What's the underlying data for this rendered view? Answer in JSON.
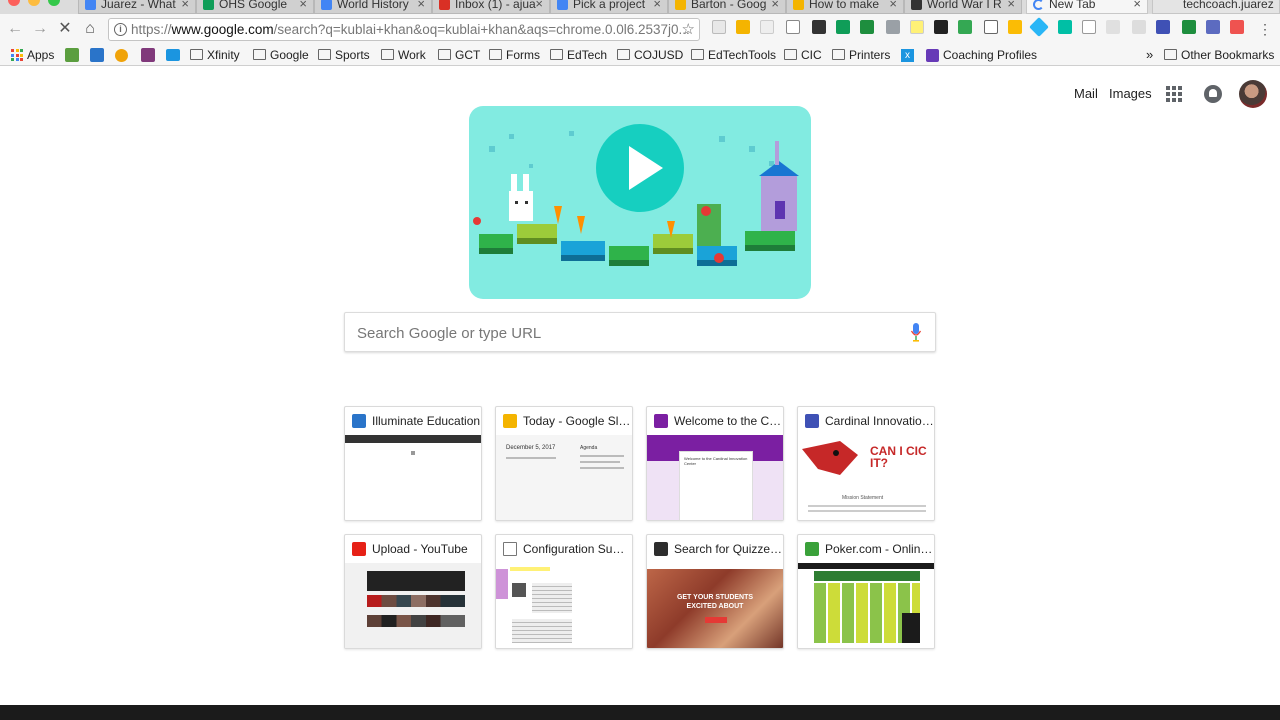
{
  "tabs": [
    {
      "title": "Juarez - What",
      "icon_color": "#4285f4"
    },
    {
      "title": "OHS Google",
      "icon_color": "#0f9d58"
    },
    {
      "title": "World History",
      "icon_color": "#4285f4"
    },
    {
      "title": "Inbox (1) - ajua",
      "icon_color": "#d93025"
    },
    {
      "title": "Pick a project",
      "icon_color": "#4285f4"
    },
    {
      "title": "Barton - Goog",
      "icon_color": "#f4b400"
    },
    {
      "title": "How to make",
      "icon_color": "#f4b400"
    },
    {
      "title": "World War I R",
      "icon_color": "#333333"
    },
    {
      "title": "New Tab",
      "icon_color": "#4285f4"
    }
  ],
  "profile_name": "techcoach.juarez",
  "omnibox": {
    "url_prefix": "https://",
    "url_domain": "www.google.com",
    "url_rest": "/search?q=kublai+khan&oq=kublai+khan&aqs=chrome.0.0l6.2537j0..."
  },
  "bookmarks": [
    {
      "label": "Apps",
      "kind": "apps"
    },
    {
      "label": "",
      "kind": "green"
    },
    {
      "label": "",
      "kind": "blue"
    },
    {
      "label": "",
      "kind": "orange-dot"
    },
    {
      "label": "",
      "kind": "onenote"
    },
    {
      "label": "",
      "kind": "twitter"
    },
    {
      "label": "Xfinity",
      "kind": "folder"
    },
    {
      "label": "Google",
      "kind": "folder"
    },
    {
      "label": "Sports",
      "kind": "folder"
    },
    {
      "label": "Work",
      "kind": "folder"
    },
    {
      "label": "GCT",
      "kind": "folder"
    },
    {
      "label": "Forms",
      "kind": "folder"
    },
    {
      "label": "EdTech",
      "kind": "folder"
    },
    {
      "label": "COJUSD",
      "kind": "folder"
    },
    {
      "label": "EdTechTools",
      "kind": "folder"
    },
    {
      "label": "CIC",
      "kind": "folder"
    },
    {
      "label": "Printers",
      "kind": "folder"
    },
    {
      "label": "",
      "kind": "x-blue"
    },
    {
      "label": "Coaching Profiles",
      "kind": "forms"
    }
  ],
  "overflow_chevron": "»",
  "other_bookmarks": "Other Bookmarks",
  "header": {
    "mail": "Mail",
    "images": "Images"
  },
  "search": {
    "placeholder": "Search Google or type URL"
  },
  "tiles": [
    {
      "title": "Illuminate Education",
      "fav": "#2a74c9"
    },
    {
      "title": "Today - Google Slides",
      "fav": "#f4b400"
    },
    {
      "title": "Welcome to the Car...",
      "fav": "#7b1fa2"
    },
    {
      "title": "Cardinal Innovation ...",
      "fav": "#3f51b5"
    },
    {
      "title": "Upload - YouTube",
      "fav": "#e62117"
    },
    {
      "title": "Configuration Sum...",
      "fav": "#ffffff"
    },
    {
      "title": "Search for Quizzes ...",
      "fav": "#2d2d2d"
    },
    {
      "title": "Poker.com - Online ...",
      "fav": "#3aa13a"
    }
  ],
  "thumb_text": {
    "slides_date": "December 5, 2017",
    "slides_agenda": "Agenda",
    "welcome": "Welcome to the Cardinal Innovation Center",
    "cic_logo": "CAN I CIC IT?",
    "mission": "Mission Statement",
    "quizzes_banner": "GET YOUR STUDENTS EXCITED ABOUT"
  },
  "colors": {
    "accent": "#4285f4",
    "doodle_bg": "#82ebe1",
    "play": "#16cfc0"
  }
}
